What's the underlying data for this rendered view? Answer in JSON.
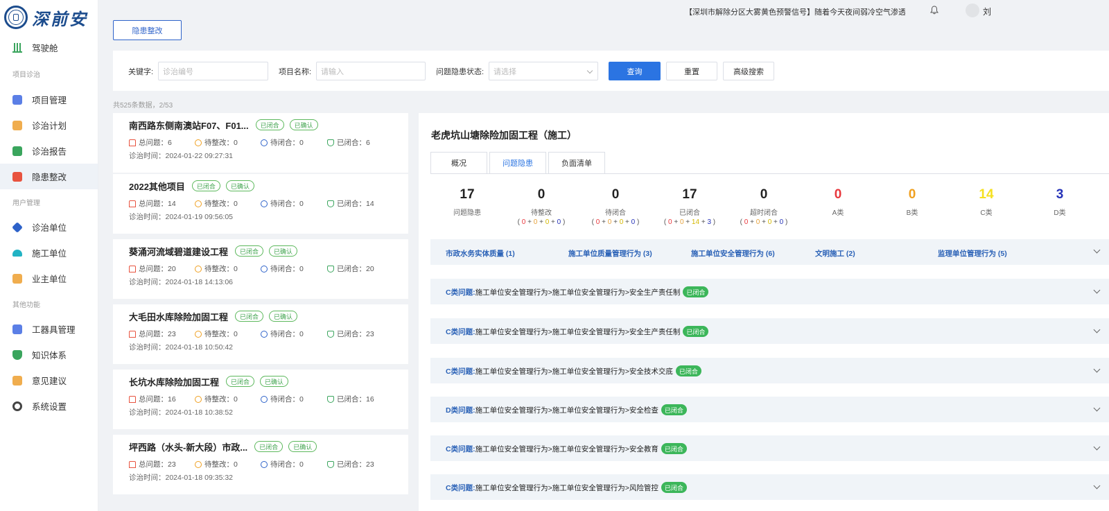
{
  "app": {
    "logo_text": "深前安"
  },
  "sidebar": {
    "items": [
      {
        "label": "驾驶舱",
        "icon": "bar-chart-icon",
        "color": "#3aa55d"
      },
      {
        "group": "项目诊治"
      },
      {
        "label": "项目管理",
        "icon": "download-box-icon",
        "color": "#5b7fe6"
      },
      {
        "label": "诊治计划",
        "icon": "calendar-icon",
        "color": "#f0ad4e"
      },
      {
        "label": "诊治报告",
        "icon": "report-icon",
        "color": "#3aa55d"
      },
      {
        "label": "隐患整改",
        "icon": "warning-flag-icon",
        "color": "#e8533f",
        "active": true
      },
      {
        "group": "用户管理"
      },
      {
        "label": "诊治单位",
        "icon": "puzzle-icon",
        "color": "#2d62c9"
      },
      {
        "label": "施工单位",
        "icon": "helmet-icon",
        "color": "#22b3c4"
      },
      {
        "label": "业主单位",
        "icon": "id-card-icon",
        "color": "#f0ad4e"
      },
      {
        "group": "其他功能"
      },
      {
        "label": "工器具管理",
        "icon": "tools-icon",
        "color": "#5b7fe6"
      },
      {
        "label": "知识体系",
        "icon": "shield-icon",
        "color": "#3aa55d"
      },
      {
        "label": "意见建议",
        "icon": "chat-icon",
        "color": "#f0ad4e"
      },
      {
        "label": "系统设置",
        "icon": "gear-icon",
        "color": "#444444"
      }
    ]
  },
  "topbar": {
    "notice": "【深圳市解除分区大雾黄色预警信号】随着今天夜间弱冷空气渗透",
    "user_name": "刘"
  },
  "page_button": "隐患整改",
  "search": {
    "keyword_label": "关键字:",
    "keyword_placeholder": "诊治编号",
    "project_label": "项目名称:",
    "project_placeholder": "请输入",
    "status_label": "问题隐患状态:",
    "status_placeholder": "请选择",
    "query_btn": "查询",
    "reset_btn": "重置",
    "advanced_btn": "高级搜索"
  },
  "count_text": "共525条数据，2/53",
  "stat_labels": {
    "total": "总问题：",
    "pending_fix": "待整改：",
    "pending_close": "待闭合：",
    "closed": "已闭合：",
    "time": "诊治时间："
  },
  "projects": [
    {
      "title": "南西路东侧南澳站F07、F01...",
      "tags": [
        "已闭合",
        "已确认"
      ],
      "total": "6",
      "pending_fix": "0",
      "pending_close": "0",
      "closed": "6",
      "time": "2024-01-22 09:27:31"
    },
    {
      "title": "2022其他项目",
      "tags": [
        "已闭合",
        "已确认"
      ],
      "total": "14",
      "pending_fix": "0",
      "pending_close": "0",
      "closed": "14",
      "time": "2024-01-19 09:56:05"
    },
    {
      "title": "葵涌河流域碧道建设工程",
      "tags": [
        "已闭合",
        "已确认"
      ],
      "total": "20",
      "pending_fix": "0",
      "pending_close": "0",
      "closed": "20",
      "time": "2024-01-18 14:13:06"
    },
    {
      "title": "大毛田水库除险加固工程",
      "tags": [
        "已闭合",
        "已确认"
      ],
      "total": "23",
      "pending_fix": "0",
      "pending_close": "0",
      "closed": "23",
      "time": "2024-01-18 10:50:42"
    },
    {
      "title": "长坑水库除险加固工程",
      "tags": [
        "已闭合",
        "已确认"
      ],
      "total": "16",
      "pending_fix": "0",
      "pending_close": "0",
      "closed": "16",
      "time": "2024-01-18 10:38:52"
    },
    {
      "title": "坪西路（水头-新大段）市政...",
      "tags": [
        "已闭合",
        "已确认"
      ],
      "total": "23",
      "pending_fix": "0",
      "pending_close": "0",
      "closed": "23",
      "time": "2024-01-18 09:35:32"
    }
  ],
  "detail": {
    "title": "老虎坑山塘除险加固工程（施工）",
    "tabs": [
      "概况",
      "问题隐患",
      "负面清单"
    ],
    "active_tab": 1,
    "metrics": [
      {
        "num": "17",
        "label": "问题隐患",
        "color": "#222222"
      },
      {
        "num": "0",
        "label": "待整改",
        "breakdown": [
          "0",
          "0",
          "0",
          "0"
        ],
        "color": "#222222"
      },
      {
        "num": "0",
        "label": "待闭合",
        "breakdown": [
          "0",
          "0",
          "0",
          "0"
        ],
        "color": "#222222"
      },
      {
        "num": "17",
        "label": "已闭合",
        "breakdown": [
          "0",
          "0",
          "14",
          "3"
        ],
        "color": "#222222"
      },
      {
        "num": "0",
        "label": "超时闭合",
        "breakdown": [
          "0",
          "0",
          "0",
          "0"
        ],
        "color": "#222222"
      },
      {
        "num": "0",
        "label": "A类",
        "color": "#e8383d"
      },
      {
        "num": "0",
        "label": "B类",
        "color": "#f0a020"
      },
      {
        "num": "14",
        "label": "C类",
        "color": "#f5e020"
      },
      {
        "num": "3",
        "label": "D类",
        "color": "#2532b8"
      }
    ],
    "categories": [
      "市政水务实体质量 (1)",
      "施工单位质量管理行为 (3)",
      "施工单位安全管理行为 (6)",
      "文明施工 (2)",
      "监理单位管理行为 (5)"
    ],
    "issues": [
      {
        "cls": "C类问题:",
        "path": "施工单位安全管理行为>施工单位安全管理行为>安全生产责任制",
        "status": "已闭合"
      },
      {
        "cls": "C类问题:",
        "path": "施工单位安全管理行为>施工单位安全管理行为>安全生产责任制",
        "status": "已闭合"
      },
      {
        "cls": "C类问题:",
        "path": "施工单位安全管理行为>施工单位安全管理行为>安全技术交底",
        "status": "已闭合"
      },
      {
        "cls": "D类问题:",
        "path": "施工单位安全管理行为>施工单位安全管理行为>安全检查",
        "status": "已闭合"
      },
      {
        "cls": "C类问题:",
        "path": "施工单位安全管理行为>施工单位安全管理行为>安全教育",
        "status": "已闭合"
      },
      {
        "cls": "C类问题:",
        "path": "施工单位安全管理行为>施工单位安全管理行为>风险管控",
        "status": "已闭合"
      }
    ]
  }
}
